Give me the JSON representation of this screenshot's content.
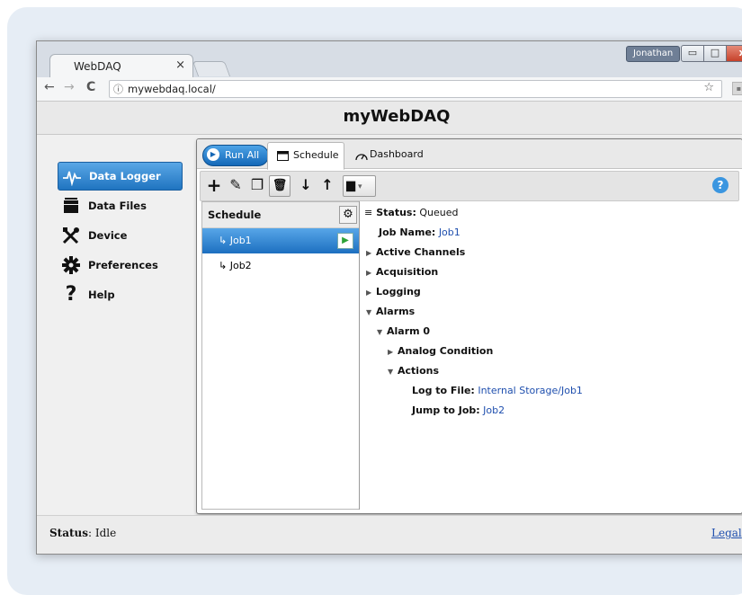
{
  "browser": {
    "tab_title": "WebDAQ",
    "tab_close": "×",
    "user_badge": "Jonathan",
    "win_min": "▭",
    "win_max": "□",
    "win_close": "x",
    "back": "←",
    "forward": "→",
    "reload": "C",
    "info": "ⓘ",
    "url": "mywebdaq.local/",
    "star": "☆",
    "menu": "⋮"
  },
  "app": {
    "title": "myWebDAQ"
  },
  "sidebar": {
    "items": [
      {
        "label": "Data Logger",
        "icon": "pulse-icon",
        "active": true
      },
      {
        "label": "Data Files",
        "icon": "folder-icon"
      },
      {
        "label": "Device",
        "icon": "tools-icon"
      },
      {
        "label": "Preferences",
        "icon": "gear-icon"
      },
      {
        "label": "Help",
        "icon": "question-icon"
      }
    ]
  },
  "panel": {
    "run_all": "Run All",
    "tabs": [
      {
        "label": "Schedule",
        "icon": "calendar-icon",
        "active": true
      },
      {
        "label": "Dashboard",
        "icon": "gauge-icon"
      }
    ],
    "toolbar": {
      "add": "+",
      "edit": "✎",
      "copy": "❐",
      "delete": "🗑",
      "down": "↓",
      "up": "↑",
      "folder": "▆",
      "folder_caret": "▾",
      "help": "?"
    },
    "schedule": {
      "header": "Schedule",
      "gear": "⚙",
      "jobs": [
        {
          "name": "↳ Job1",
          "selected": true
        },
        {
          "name": "↳ Job2",
          "selected": false
        }
      ],
      "play": "▶"
    },
    "details": {
      "status_label": "Status:",
      "status_value": "Queued",
      "job_name_label": "Job Name:",
      "job_name_value": "Job1",
      "active_channels": "Active Channels",
      "acquisition": "Acquisition",
      "logging": "Logging",
      "alarms": "Alarms",
      "alarm0": "Alarm 0",
      "analog_condition": "Analog Condition",
      "actions": "Actions",
      "log_to_file_label": "Log to File:",
      "log_to_file_value": "Internal Storage/Job1",
      "jump_to_job_label": "Jump to Job:",
      "jump_to_job_value": "Job2",
      "tri_collapsed": "▶",
      "tri_expanded": "▼"
    }
  },
  "statusbar": {
    "label": "Status",
    "value": ": Idle",
    "legal": "Legal"
  },
  "colors": {
    "accent": "#1f74c0",
    "link": "#1f4fae",
    "play_green": "#2da337"
  }
}
